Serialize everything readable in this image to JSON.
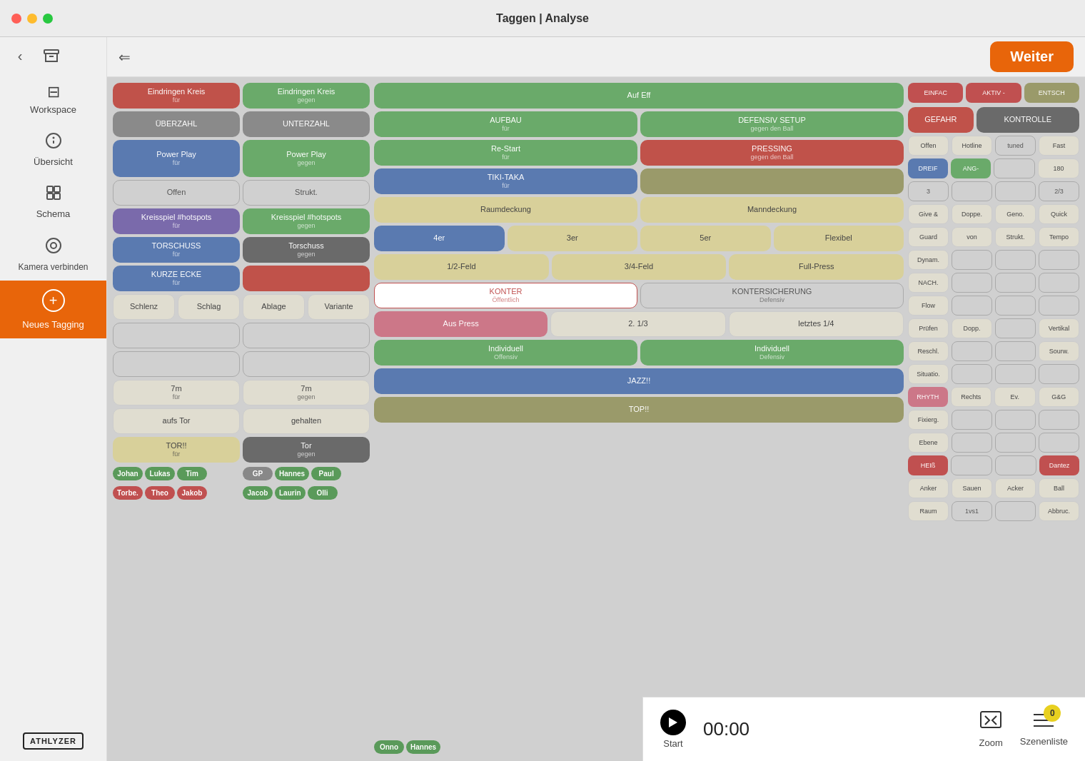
{
  "titlebar": {
    "title": "Taggen | Analyse"
  },
  "sidebar": {
    "back_icon": "‹",
    "archive_icon": "⊟",
    "workspace_label": "Workspace",
    "overview_icon": "ℹ",
    "overview_label": "Übersicht",
    "schema_icon": "⊞",
    "schema_label": "Schema",
    "camera_icon": "◉",
    "camera_label": "Kamera verbinden",
    "new_tagging_icon": "+",
    "new_tagging_label": "Neues Tagging",
    "logo_text": "ATHLYZER"
  },
  "top_bar": {
    "back_label": "⇐",
    "weiter_label": "Weiter"
  },
  "tags": {
    "left_col1": [
      {
        "label": "Eindringen Kreis",
        "sub": "für",
        "color": "red"
      },
      {
        "label": "ÜBERZAHL",
        "sub": "",
        "color": "gray"
      },
      {
        "label": "Power Play",
        "sub": "für",
        "color": "blue"
      },
      {
        "label": "",
        "sub": "",
        "color": "outline"
      },
      {
        "label": "Kreisspiel #hotspots",
        "sub": "für",
        "color": "purple"
      },
      {
        "label": "TORSCHUSS",
        "sub": "für",
        "color": "blue"
      },
      {
        "label": "KURZE ECKE",
        "sub": "für",
        "color": "blue"
      },
      {
        "label": "Schlenz",
        "sub": "",
        "color": "light"
      },
      {
        "label": "",
        "sub": "",
        "color": "outline"
      },
      {
        "label": "",
        "sub": "",
        "color": "outline"
      },
      {
        "label": "7m",
        "sub": "für",
        "color": "light"
      },
      {
        "label": "aufs Tor",
        "sub": "",
        "color": "light"
      },
      {
        "label": "TOR!!",
        "sub": "für",
        "color": "light-yellow"
      }
    ],
    "left_col2": [
      {
        "label": "Eindringen Kreis",
        "sub": "gegen",
        "color": "green"
      },
      {
        "label": "UNTERZAHL",
        "sub": "",
        "color": "gray"
      },
      {
        "label": "Power Play",
        "sub": "gegen",
        "color": "green"
      },
      {
        "label": "Strukt.",
        "sub": "",
        "color": "outline"
      },
      {
        "label": "Kreisspiel #hotspots",
        "sub": "gegen",
        "color": "green"
      },
      {
        "label": "Torschuss",
        "sub": "gegen",
        "color": "dark-gray"
      },
      {
        "label": "",
        "sub": "",
        "color": "red"
      },
      {
        "label": "Schlag",
        "sub": "",
        "color": "light"
      },
      {
        "label": "Ablage",
        "sub": "",
        "color": "light"
      },
      {
        "label": "Variante",
        "sub": "",
        "color": "light"
      },
      {
        "label": "7m",
        "sub": "gegen",
        "color": "light"
      },
      {
        "label": "gehalten",
        "sub": "",
        "color": "light"
      },
      {
        "label": "Tor",
        "sub": "gegen",
        "color": "dark-gray"
      }
    ],
    "middle": [
      {
        "label": "Auf Eff",
        "sub": "",
        "color": "green",
        "row": 0
      },
      {
        "label": "AUFBAU",
        "sub": "für",
        "color": "green",
        "row": 1
      },
      {
        "label": "DEFENSIV SETUP",
        "sub": "gegen den Ball",
        "color": "green",
        "row": 1
      },
      {
        "label": "Re-Start",
        "sub": "für",
        "color": "green",
        "row": 2
      },
      {
        "label": "PRESSING",
        "sub": "gegen den Ball",
        "color": "red",
        "row": 2
      },
      {
        "label": "TIKI-TAKA",
        "sub": "für",
        "color": "blue",
        "row": 3
      },
      {
        "label": "",
        "sub": "",
        "color": "olive",
        "row": 3
      },
      {
        "label": "Raumdeckung",
        "sub": "",
        "color": "light-yellow",
        "row": 4
      },
      {
        "label": "Manndeckung",
        "sub": "",
        "color": "light-yellow",
        "row": 4
      },
      {
        "label": "4er",
        "sub": "",
        "color": "blue",
        "row": 5
      },
      {
        "label": "3er",
        "sub": "",
        "color": "light-yellow",
        "row": 5
      },
      {
        "label": "5er",
        "sub": "",
        "color": "light-yellow",
        "row": 5
      },
      {
        "label": "Flexibel",
        "sub": "",
        "color": "light-yellow",
        "row": 5
      },
      {
        "label": "1/2-Feld",
        "sub": "",
        "color": "light-yellow",
        "row": 6
      },
      {
        "label": "3/4-Feld",
        "sub": "",
        "color": "light-yellow",
        "row": 6
      },
      {
        "label": "Full-Press",
        "sub": "",
        "color": "light-yellow",
        "row": 6
      },
      {
        "label": "KONTER",
        "sub": "Öffentlich",
        "color": "outline-red",
        "row": 7
      },
      {
        "label": "KONTERSICHERUNG",
        "sub": "Defensiv",
        "color": "outline",
        "row": 7
      },
      {
        "label": "Aus Press",
        "sub": "",
        "color": "pink",
        "row": 8
      },
      {
        "label": "2. 1/3",
        "sub": "",
        "color": "light",
        "row": 8
      },
      {
        "label": "letztes 1/4",
        "sub": "",
        "color": "light",
        "row": 8
      },
      {
        "label": "Individuell",
        "sub": "Offensiv",
        "color": "green",
        "row": 9
      },
      {
        "label": "Individuell",
        "sub": "Defensiv",
        "color": "green",
        "row": 9
      },
      {
        "label": "JAZZ!!",
        "sub": "",
        "color": "blue",
        "row": 10
      },
      {
        "label": "TOP!!",
        "sub": "",
        "color": "olive",
        "row": 11
      }
    ],
    "right_top": [
      {
        "label": "EINFAC",
        "color": "red"
      },
      {
        "label": "AKTIV -",
        "color": "red"
      },
      {
        "label": "ENTSCH",
        "color": "olive"
      }
    ],
    "right_col1": [
      {
        "label": "GEFAHR",
        "color": "red"
      },
      {
        "label": "Offen",
        "color": "light"
      },
      {
        "label": "DREIF",
        "color": "blue"
      },
      {
        "label": "3",
        "color": "outline"
      },
      {
        "label": "Give &",
        "color": "light"
      },
      {
        "label": "Guard",
        "color": "light"
      },
      {
        "label": "Dynam.",
        "color": "light"
      },
      {
        "label": "NACH.",
        "color": "light"
      },
      {
        "label": "Flow",
        "color": "light"
      },
      {
        "label": "Prüfen",
        "color": "light"
      },
      {
        "label": "Reschl.",
        "color": "light"
      },
      {
        "label": "Situatio.",
        "color": "light"
      },
      {
        "label": "RHYTH",
        "color": "pink"
      },
      {
        "label": "Fixierg.",
        "color": "light"
      },
      {
        "label": "Ebene",
        "color": "light"
      },
      {
        "label": "HEIß",
        "color": "red"
      },
      {
        "label": "Anker",
        "color": "light"
      },
      {
        "label": "Raum",
        "color": "light"
      }
    ],
    "right_col2": [
      {
        "label": "KONTROLLE",
        "color": "dark-gray"
      },
      {
        "label": "Hotline",
        "color": "light"
      },
      {
        "label": "ANG-",
        "color": "green"
      },
      {
        "label": "",
        "color": "outline"
      },
      {
        "label": "Doppe.",
        "color": "light"
      },
      {
        "label": "von",
        "color": "light"
      },
      {
        "label": "",
        "color": "outline"
      },
      {
        "label": "",
        "color": "outline"
      },
      {
        "label": "",
        "color": "outline"
      },
      {
        "label": "Dopp.",
        "color": "light"
      },
      {
        "label": "",
        "color": "outline"
      },
      {
        "label": "",
        "color": "outline"
      },
      {
        "label": "Rechts",
        "color": "light"
      },
      {
        "label": "",
        "color": "outline"
      },
      {
        "label": "",
        "color": "outline"
      },
      {
        "label": "Sauen",
        "color": "light"
      },
      {
        "label": "",
        "color": "outline"
      },
      {
        "label": "1vs1",
        "color": "outline"
      }
    ],
    "right_col3": [
      {
        "label": "",
        "color": "outline"
      },
      {
        "label": "Fast",
        "color": "light"
      },
      {
        "label": "180",
        "color": "light"
      },
      {
        "label": "2/3",
        "color": "outline"
      },
      {
        "label": "Quick",
        "color": "light"
      },
      {
        "label": "Strukt.",
        "color": "light"
      },
      {
        "label": "Tempo",
        "color": "light"
      },
      {
        "label": "",
        "color": "outline"
      },
      {
        "label": "",
        "color": "outline"
      },
      {
        "label": "Vertikal",
        "color": "light"
      },
      {
        "label": "Sourw.",
        "color": "light"
      },
      {
        "label": "",
        "color": "outline"
      },
      {
        "label": "G&G",
        "color": "light"
      },
      {
        "label": "Ev.",
        "color": "light"
      },
      {
        "label": "",
        "color": "outline"
      },
      {
        "label": "Dantez",
        "color": "red"
      },
      {
        "label": "Acker",
        "color": "light"
      },
      {
        "label": "Ball",
        "color": "light"
      },
      {
        "label": "Abbruc.",
        "color": "light"
      }
    ],
    "right_col4": [
      {
        "label": "tuned",
        "color": "outline"
      },
      {
        "label": "",
        "color": "outline"
      },
      {
        "label": "",
        "color": "outline"
      },
      {
        "label": "",
        "color": "outline"
      },
      {
        "label": "Geno.",
        "color": "light"
      },
      {
        "label": "Strukt.",
        "color": "light"
      },
      {
        "label": "",
        "color": "outline"
      },
      {
        "label": "",
        "color": "outline"
      },
      {
        "label": "",
        "color": "outline"
      },
      {
        "label": "",
        "color": "outline"
      },
      {
        "label": "",
        "color": "outline"
      },
      {
        "label": "",
        "color": "outline"
      },
      {
        "label": "",
        "color": "outline"
      },
      {
        "label": "",
        "color": "outline"
      },
      {
        "label": "",
        "color": "outline"
      },
      {
        "label": "",
        "color": "outline"
      },
      {
        "label": "Acker",
        "color": "outline"
      },
      {
        "label": "",
        "color": "outline"
      }
    ]
  },
  "players": {
    "row1": [
      {
        "name": "Johan",
        "color": "green"
      },
      {
        "name": "Lukas",
        "color": "green"
      },
      {
        "name": "Tim",
        "color": "green"
      },
      {
        "name": "GP",
        "color": "gray"
      },
      {
        "name": "Hannes",
        "color": "green"
      },
      {
        "name": "Paul",
        "color": "green"
      },
      {
        "name": "Jacob",
        "color": "green"
      },
      {
        "name": "Laurin",
        "color": "green"
      },
      {
        "name": "Olli",
        "color": "green"
      },
      {
        "name": "Onno",
        "color": "green"
      },
      {
        "name": "Hannes",
        "color": "green"
      }
    ],
    "row2": [
      {
        "name": "Torbe.",
        "color": "red"
      },
      {
        "name": "Theo",
        "color": "red"
      },
      {
        "name": "Jakob",
        "color": "red"
      }
    ]
  },
  "video_controls": {
    "start_label": "Start",
    "time": "00:00",
    "zoom_label": "Zoom",
    "list_label": "Szenenliste",
    "badge_count": "0"
  }
}
